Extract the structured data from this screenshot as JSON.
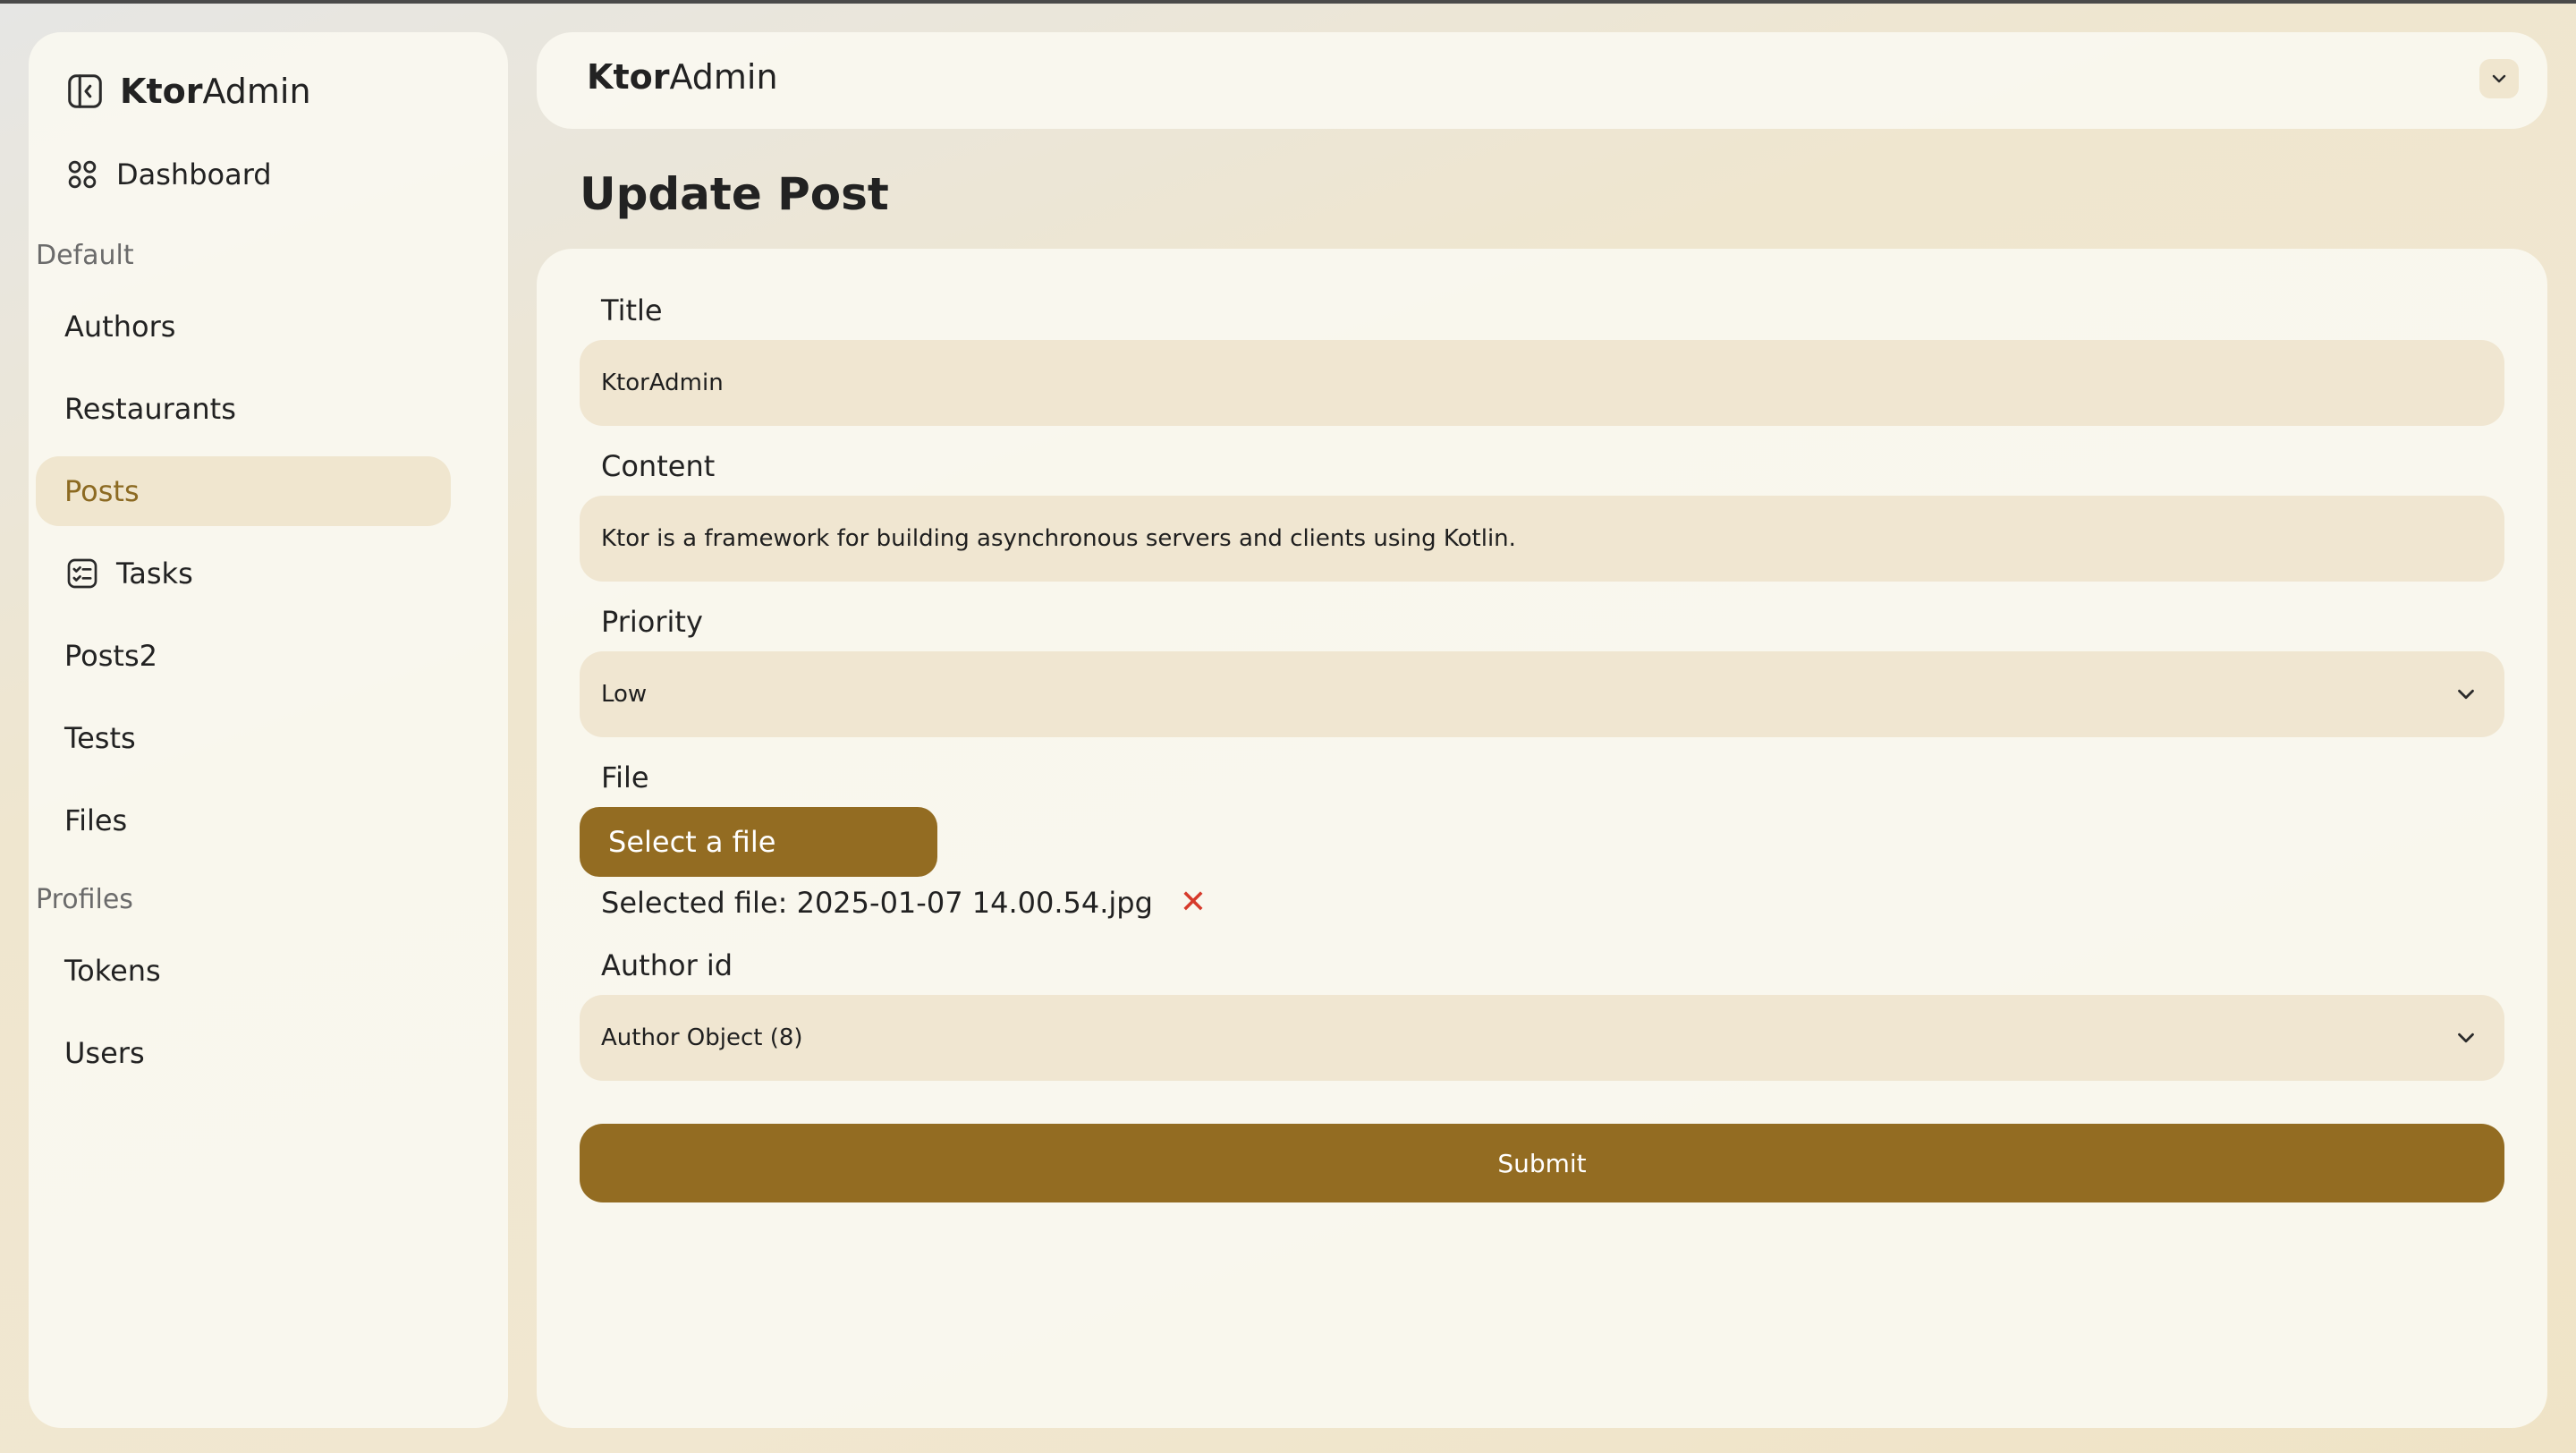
{
  "brand": {
    "bold": "Ktor",
    "rest": "Admin"
  },
  "sidebar": {
    "dashboard": "Dashboard",
    "sections": [
      {
        "label": "Default",
        "items": [
          "Authors",
          "Restaurants",
          "Posts",
          "Tasks",
          "Posts2",
          "Tests",
          "Files"
        ]
      },
      {
        "label": "Profiles",
        "items": [
          "Tokens",
          "Users"
        ]
      }
    ],
    "active_item": "Posts"
  },
  "header": {
    "title_bold": "Ktor",
    "title_rest": "Admin"
  },
  "page": {
    "title": "Update Post"
  },
  "form": {
    "title_label": "Title",
    "title_value": "KtorAdmin",
    "content_label": "Content",
    "content_value": "Ktor is a framework for building asynchronous servers and clients using Kotlin.",
    "priority_label": "Priority",
    "priority_value": "Low",
    "file_label": "File",
    "file_button": "Select a file",
    "selected_file": "Selected file: 2025-01-07 14.00.54.jpg",
    "remove_icon": "✕",
    "author_label": "Author id",
    "author_value": "Author Object (8)",
    "submit": "Submit"
  },
  "colors": {
    "accent": "#936c22",
    "active_bg": "#f0e6cf",
    "field_bg": "#f0e6d1",
    "remove": "#d63a2b"
  },
  "icons": [
    "sidebar-toggle-icon",
    "dashboard-grid-icon",
    "tasks-checklist-icon",
    "chevron-down-icon",
    "close-icon"
  ]
}
